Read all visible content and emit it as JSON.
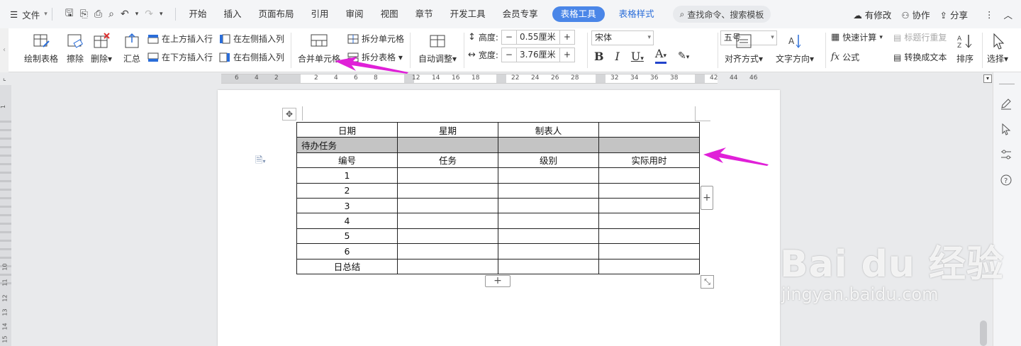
{
  "menubar": {
    "file_label": "文件",
    "tabs": [
      {
        "label": "开始"
      },
      {
        "label": "插入"
      },
      {
        "label": "页面布局"
      },
      {
        "label": "引用"
      },
      {
        "label": "审阅"
      },
      {
        "label": "视图"
      },
      {
        "label": "章节"
      },
      {
        "label": "开发工具"
      },
      {
        "label": "会员专享"
      }
    ],
    "active_tab": "表格工具",
    "context_tab": "表格样式",
    "search_placeholder": "查找命令、搜索模板",
    "right": {
      "modified": "有修改",
      "collaborate": "协作",
      "share": "分享"
    }
  },
  "ribbon": {
    "draw_table": "绘制表格",
    "erase": "擦除",
    "delete": "删除",
    "summary": "汇总",
    "insert_above": "在上方插入行",
    "insert_below": "在下方插入行",
    "insert_left": "在左侧插入列",
    "insert_right": "在右侧插入列",
    "merge_cells": "合并单元格",
    "split_cells": "拆分单元格",
    "split_table": "拆分表格",
    "auto_fit": "自动调整",
    "height_label": "高度:",
    "height_value": "0.55厘米",
    "width_label": "宽度:",
    "width_value": "3.76厘米",
    "font_name": "宋体",
    "font_size": "五号",
    "align": "对齐方式",
    "text_direction": "文字方向",
    "quick_calc": "快速计算",
    "repeat_header": "标题行重复",
    "formula": "公式",
    "to_text": "转换成文本",
    "sort": "排序",
    "select": "选择"
  },
  "ruler": {
    "ticks": [
      "6",
      "4",
      "2",
      "2",
      "4",
      "6",
      "8",
      "12",
      "14",
      "16",
      "18",
      "22",
      "24",
      "26",
      "28",
      "32",
      "34",
      "36",
      "38",
      "42",
      "44",
      "46"
    ]
  },
  "vruler": {
    "ticks": [
      "1",
      "10",
      "11",
      "12",
      "13",
      "14",
      "15"
    ]
  },
  "table": {
    "header": [
      "日期",
      "星期",
      "制表人",
      ""
    ],
    "selected_row": [
      "待办任务",
      "",
      "",
      ""
    ],
    "col_headers": [
      "编号",
      "任务",
      "级别",
      "实际用时"
    ],
    "rows": [
      [
        "1",
        "",
        "",
        ""
      ],
      [
        "2",
        "",
        "",
        ""
      ],
      [
        "3",
        "",
        "",
        ""
      ],
      [
        "4",
        "",
        "",
        ""
      ],
      [
        "5",
        "",
        "",
        ""
      ],
      [
        "6",
        "",
        "",
        ""
      ]
    ],
    "footer": [
      "日总结",
      "",
      "",
      ""
    ]
  },
  "colors": {
    "accent": "#4a86e8",
    "selection": "#c4c4c4",
    "arrow": "#e020d8"
  },
  "watermark": {
    "logo": "Bai du 经验",
    "url": "jingyan.baidu.com"
  }
}
